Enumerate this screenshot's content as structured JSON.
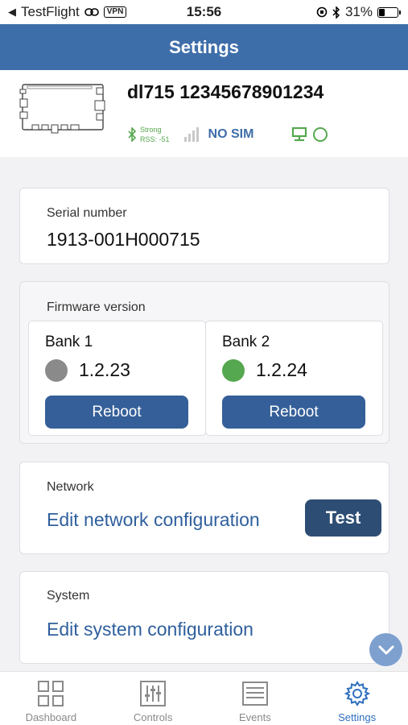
{
  "status_bar": {
    "back_app": "TestFlight",
    "vpn": "VPN",
    "time": "15:56",
    "battery": "31%",
    "battery_level": 0.31
  },
  "header": {
    "title": "Settings"
  },
  "device": {
    "name": "dl715 12345678901234",
    "signal_strength": "Strong",
    "rss": "RSS: -51",
    "sim_status": "NO SIM"
  },
  "serial": {
    "label": "Serial number",
    "value": "1913-001H000715"
  },
  "firmware": {
    "label": "Firmware version",
    "banks": [
      {
        "name": "Bank 1",
        "version": "1.2.23",
        "status_color": "#8a8a8a",
        "button": "Reboot"
      },
      {
        "name": "Bank 2",
        "version": "1.2.24",
        "status_color": "#55a84f",
        "button": "Reboot"
      }
    ]
  },
  "network": {
    "label": "Network",
    "link": "Edit network configuration",
    "test_button": "Test"
  },
  "system": {
    "label": "System",
    "link": "Edit system configuration"
  },
  "tabs": [
    {
      "label": "Dashboard",
      "icon": "dashboard-icon"
    },
    {
      "label": "Controls",
      "icon": "controls-icon"
    },
    {
      "label": "Events",
      "icon": "events-icon"
    },
    {
      "label": "Settings",
      "icon": "settings-icon",
      "active": true
    }
  ],
  "colors": {
    "header": "#3e6eaa",
    "button": "#355f98",
    "test_button": "#2d4d74",
    "active_tab": "#2f6fbf",
    "link": "#2f5f9d"
  }
}
